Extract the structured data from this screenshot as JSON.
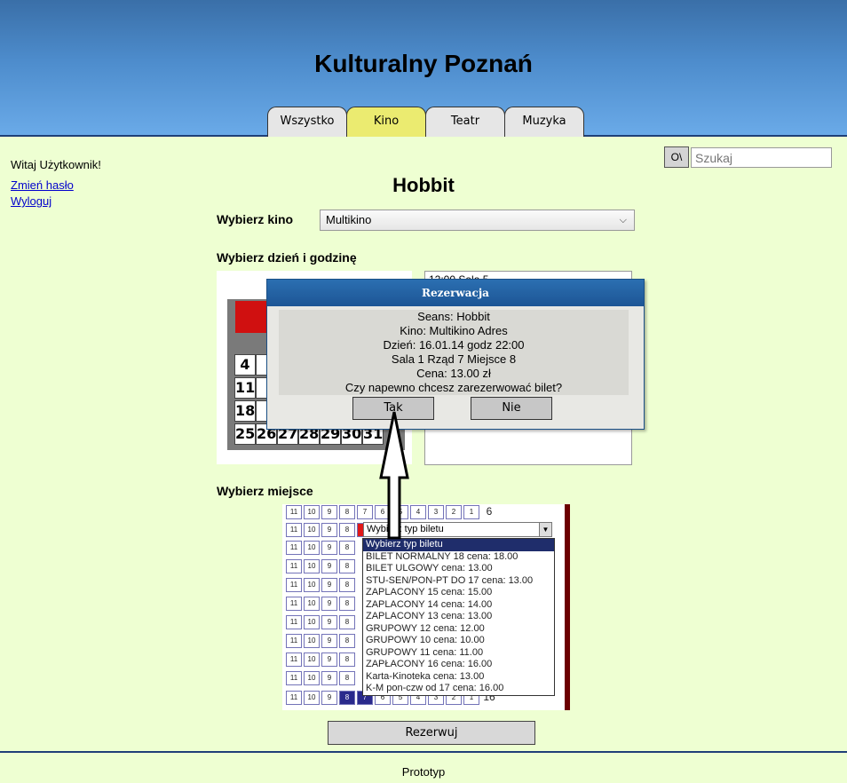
{
  "header": {
    "title": "Kulturalny Poznań"
  },
  "tabs": [
    {
      "label": "Wszystko",
      "active": false
    },
    {
      "label": "Kino",
      "active": true
    },
    {
      "label": "Teatr",
      "active": false
    },
    {
      "label": "Muzyka",
      "active": false
    }
  ],
  "sidebar": {
    "welcome": "Witaj Użytkownik!",
    "change_password": "Zmień hasło",
    "logout": "Wyloguj"
  },
  "search": {
    "button_label": "O\\",
    "placeholder": "Szukaj"
  },
  "main": {
    "title": "Hobbit",
    "cinema_label": "Wybierz kino",
    "cinema_value": "Multikino",
    "date_label": "Wybierz dzień i godzinę",
    "seat_label": "Wybierz miejsce",
    "reserve_button": "Rezerwuj"
  },
  "calendar": {
    "rows": [
      [
        "4",
        "",
        "",
        "",
        "",
        "",
        ""
      ],
      [
        "11",
        "",
        "",
        "",
        "",
        "",
        ""
      ],
      [
        "18",
        "",
        "",
        "",
        "",
        "",
        ""
      ],
      [
        "25",
        "26",
        "27",
        "28",
        "29",
        "30",
        "31"
      ]
    ]
  },
  "times": {
    "first_item": "12:00 Sala 5"
  },
  "seats": {
    "row_top": [
      "11",
      "10",
      "9",
      "8",
      "7",
      "6",
      "5",
      "4",
      "3",
      "2",
      "1",
      "6"
    ],
    "row_left": [
      "11",
      "10",
      "9",
      "8"
    ],
    "selected_seat": "8",
    "row_bottom": [
      "11",
      "10",
      "9",
      "8",
      "7",
      "6",
      "5",
      "4",
      "3",
      "2",
      "1",
      "16"
    ]
  },
  "ticket_select": {
    "value": "Wybierz typ biletu",
    "options": [
      "Wybierz typ biletu",
      "BILET NORMALNY 18 cena: 18.00",
      "BILET ULGOWY cena: 13.00",
      "STU-SEN/PON-PT DO 17 cena: 13.00",
      "ZAPLACONY 15 cena: 15.00",
      "ZAPLACONY 14 cena: 14.00",
      "ZAPLACONY 13 cena: 13.00",
      "GRUPOWY 12 cena: 12.00",
      "GRUPOWY 10 cena: 10.00",
      "GRUPOWY 11 cena: 11.00",
      "ZAPŁACONY 16 cena: 16.00",
      "Karta-Kinoteka cena: 13.00",
      "K-M pon-czw od 17 cena: 16.00"
    ]
  },
  "dialog": {
    "title": "Rezerwacja",
    "lines": [
      "Seans: Hobbit",
      "Kino: Multikino Adres",
      "Dzień: 16.01.14 godz 22:00",
      "Sala 1 Rząd 7 Miejsce 8",
      "Cena: 13.00 zł",
      "Czy napewno chcesz zarezerwować bilet?"
    ],
    "yes": "Tak",
    "no": "Nie"
  },
  "footer": {
    "text": "Prototyp"
  },
  "colors": {
    "background": "#eeffd2",
    "active_tab": "#ebeb70",
    "dialog_title": "#1d5595"
  }
}
